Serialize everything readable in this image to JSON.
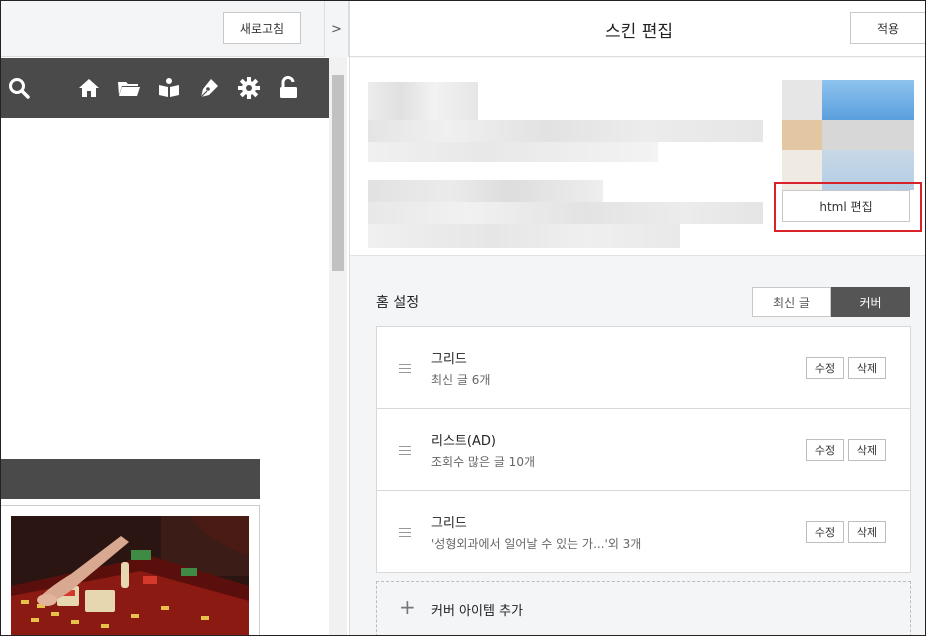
{
  "preview": {
    "refresh_label": "새로고침",
    "collapse_glyph": ">",
    "toolbar_icons": [
      "search-icon",
      "home-icon",
      "folder-icon",
      "reader-icon",
      "pen-icon",
      "gear-icon",
      "unlock-icon"
    ]
  },
  "editor": {
    "title": "스킨 편집",
    "apply_label": "적용",
    "html_edit_label": "html 편집",
    "home_settings_label": "홈 설정",
    "tabs": [
      {
        "label": "최신 글",
        "active": false
      },
      {
        "label": "커버",
        "active": true
      }
    ],
    "items": [
      {
        "title": "그리드",
        "subtitle": "최신 글 6개",
        "edit_label": "수정",
        "delete_label": "삭제"
      },
      {
        "title": "리스트(AD)",
        "subtitle": "조회수 많은 글 10개",
        "edit_label": "수정",
        "delete_label": "삭제"
      },
      {
        "title": "그리드",
        "subtitle": "'성형외과에서 일어날 수 있는 가...'외 3개",
        "edit_label": "수정",
        "delete_label": "삭제"
      }
    ],
    "add_item_label": "커버 아이템 추가"
  },
  "colors": {
    "highlight": "#d9232b",
    "toolbar_bg": "#4a4a4a",
    "active_tab_bg": "#555555"
  }
}
